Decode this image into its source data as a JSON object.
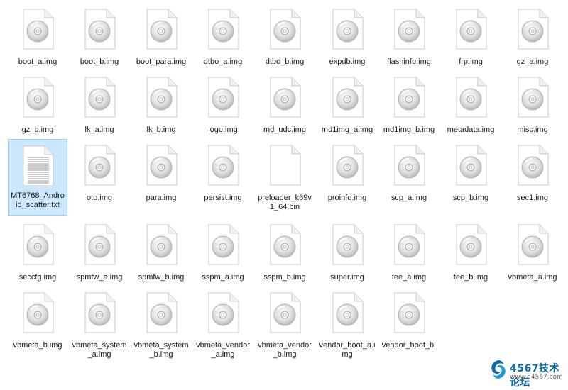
{
  "files": [
    [
      {
        "name": "boot_a.img",
        "type": "disc"
      },
      {
        "name": "boot_b.img",
        "type": "disc"
      },
      {
        "name": "boot_para.img",
        "type": "disc"
      },
      {
        "name": "dtbo_a.img",
        "type": "disc"
      },
      {
        "name": "dtbo_b.img",
        "type": "disc"
      },
      {
        "name": "expdb.img",
        "type": "disc"
      },
      {
        "name": "flashinfo.img",
        "type": "disc"
      },
      {
        "name": "frp.img",
        "type": "disc"
      },
      {
        "name": "gz_a.img",
        "type": "disc"
      }
    ],
    [
      {
        "name": "gz_b.img",
        "type": "disc"
      },
      {
        "name": "lk_a.img",
        "type": "disc"
      },
      {
        "name": "lk_b.img",
        "type": "disc"
      },
      {
        "name": "logo.img",
        "type": "disc"
      },
      {
        "name": "md_udc.img",
        "type": "disc"
      },
      {
        "name": "md1img_a.img",
        "type": "disc"
      },
      {
        "name": "md1img_b.img",
        "type": "disc"
      },
      {
        "name": "metadata.img",
        "type": "disc"
      },
      {
        "name": "misc.img",
        "type": "disc"
      }
    ],
    [
      {
        "name": "MT6768_Android_scatter.txt",
        "type": "text",
        "selected": true
      },
      {
        "name": "otp.img",
        "type": "disc"
      },
      {
        "name": "para.img",
        "type": "disc"
      },
      {
        "name": "persist.img",
        "type": "disc"
      },
      {
        "name": "preloader_k69v1_64.bin",
        "type": "blank"
      },
      {
        "name": "proinfo.img",
        "type": "disc"
      },
      {
        "name": "scp_a.img",
        "type": "disc"
      },
      {
        "name": "scp_b.img",
        "type": "disc"
      },
      {
        "name": "sec1.img",
        "type": "disc"
      }
    ],
    [
      {
        "name": "seccfg.img",
        "type": "disc"
      },
      {
        "name": "spmfw_a.img",
        "type": "disc"
      },
      {
        "name": "spmfw_b.img",
        "type": "disc"
      },
      {
        "name": "sspm_a.img",
        "type": "disc"
      },
      {
        "name": "sspm_b.img",
        "type": "disc"
      },
      {
        "name": "super.img",
        "type": "disc"
      },
      {
        "name": "tee_a.img",
        "type": "disc"
      },
      {
        "name": "tee_b.img",
        "type": "disc"
      },
      {
        "name": "vbmeta_a.img",
        "type": "disc"
      }
    ],
    [
      {
        "name": "vbmeta_b.img",
        "type": "disc"
      },
      {
        "name": "vbmeta_system_a.img",
        "type": "disc"
      },
      {
        "name": "vbmeta_system_b.img",
        "type": "disc"
      },
      {
        "name": "vbmeta_vendor_a.img",
        "type": "disc"
      },
      {
        "name": "vbmeta_vendor_b.img",
        "type": "disc"
      },
      {
        "name": "vendor_boot_a.img",
        "type": "disc"
      },
      {
        "name": "vendor_boot_b.",
        "type": "disc"
      }
    ]
  ],
  "watermark": {
    "title": "4567技术论坛",
    "url": "www.d4567.com"
  },
  "colors": {
    "selection_bg": "#cce8ff",
    "selection_border": "#99d1ff",
    "watermark_blue": "#0b6aa8"
  }
}
